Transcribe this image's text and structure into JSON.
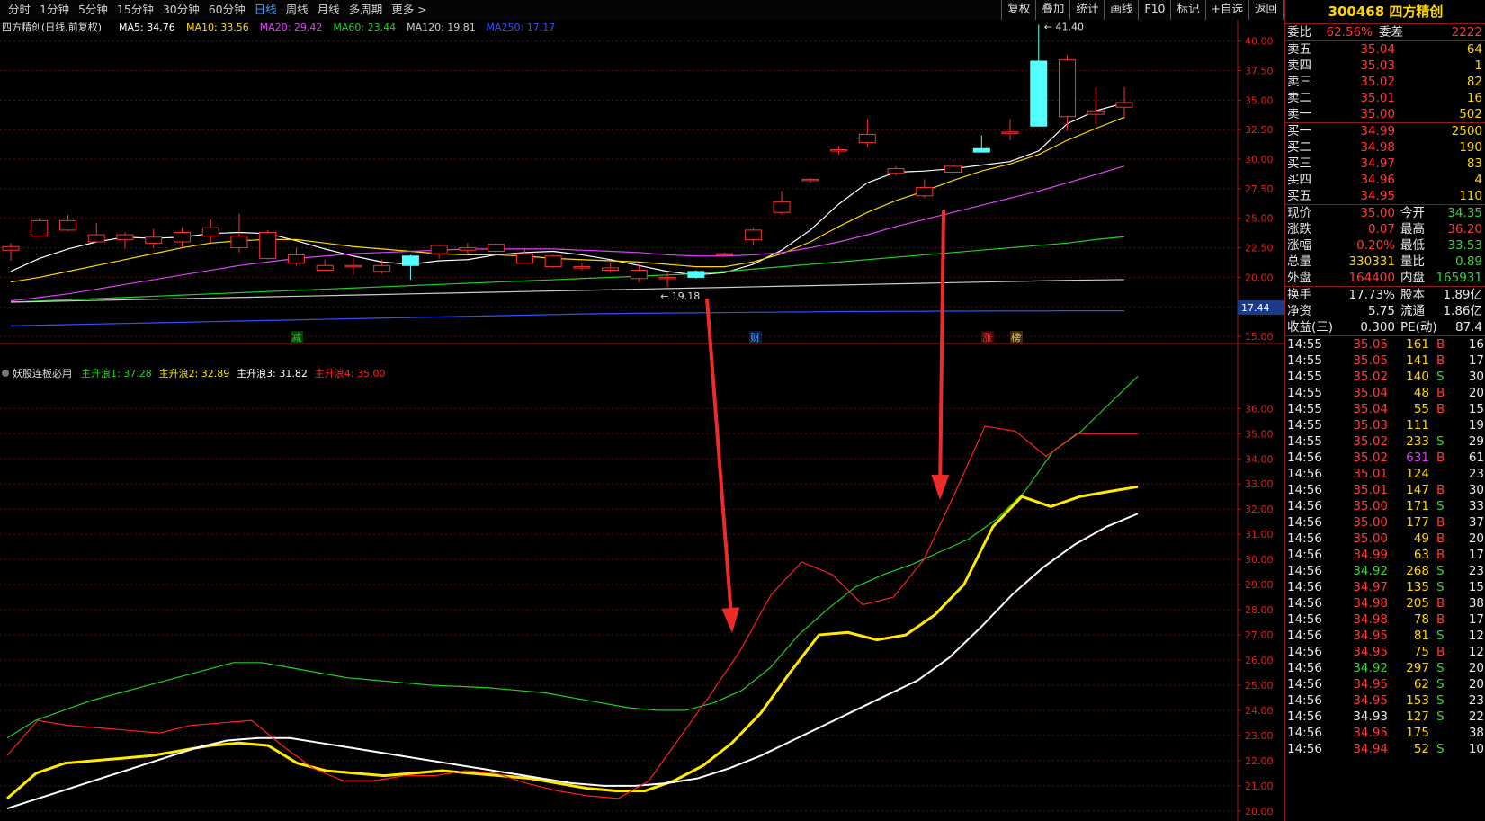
{
  "toolbar": {
    "periods": [
      "分时",
      "1分钟",
      "5分钟",
      "15分钟",
      "30分钟",
      "60分钟",
      "日线",
      "周线",
      "月线",
      "多周期",
      "更多"
    ],
    "active_period": "日线",
    "tools": [
      "复权",
      "叠加",
      "统计",
      "画线",
      "F10",
      "标记",
      "+自选",
      "返回"
    ]
  },
  "main_chart": {
    "title": "四方精创(日线,前复权)",
    "ma": [
      {
        "label": "MA5: 34.76",
        "color": "#ffffff"
      },
      {
        "label": "MA10: 33.56",
        "color": "#ffd700"
      },
      {
        "label": "MA20: 29.42",
        "color": "#e040fb"
      },
      {
        "label": "MA60: 23.44",
        "color": "#20d020"
      },
      {
        "label": "MA120: 19.81",
        "color": "#cccccc"
      },
      {
        "label": "MA250: 17.17",
        "color": "#3050ff"
      }
    ],
    "y_ticks": [
      "40.00",
      "37.50",
      "35.00",
      "32.50",
      "30.00",
      "27.50",
      "25.00",
      "22.50",
      "20.00",
      "17.50",
      "15.00"
    ],
    "price_flag": "17.44",
    "high_note": "41.40",
    "low_note": "19.18",
    "markers": [
      "减",
      "财",
      "涨",
      "榜"
    ]
  },
  "indicator": {
    "name": "妖股连板必用",
    "lines": [
      {
        "label": "主升浪1: 37.28",
        "color": "#20d020"
      },
      {
        "label": "主升浪2: 32.89",
        "color": "#ffea00"
      },
      {
        "label": "主升浪3: 31.82",
        "color": "#ffffff"
      },
      {
        "label": "主升浪4: 35.00",
        "color": "#ff2020"
      }
    ],
    "y_ticks": [
      "36.00",
      "35.00",
      "34.00",
      "33.00",
      "32.00",
      "31.00",
      "30.00",
      "29.00",
      "28.00",
      "27.00",
      "26.00",
      "25.00",
      "24.00",
      "23.00",
      "22.00",
      "21.00",
      "20.00"
    ]
  },
  "chart_data": {
    "type": "line",
    "title": "四方精创(日线,前复权)",
    "x": [
      "1",
      "2",
      "3",
      "4",
      "5",
      "6",
      "7",
      "8",
      "9",
      "10",
      "11",
      "12",
      "13",
      "14",
      "15",
      "16",
      "17",
      "18",
      "19",
      "20",
      "21",
      "22",
      "23",
      "24",
      "25",
      "26",
      "27",
      "28",
      "29",
      "30",
      "31",
      "32",
      "33",
      "34",
      "35",
      "36",
      "37",
      "38",
      "39"
    ],
    "ylim": [
      15,
      41.4
    ],
    "candles": {
      "open": [
        22.3,
        23.5,
        24.0,
        23.0,
        23.2,
        22.9,
        23.0,
        23.5,
        22.5,
        21.6,
        21.2,
        20.6,
        20.9,
        20.5,
        21.8,
        22.0,
        22.3,
        22.2,
        21.2,
        20.9,
        20.8,
        20.6,
        19.9,
        20.0,
        20.5,
        22.0,
        23.2,
        25.5,
        28.2,
        30.8,
        31.4,
        28.8,
        26.9,
        28.9,
        30.9,
        32.3,
        38.3,
        33.6,
        33.8,
        34.4
      ],
      "close": [
        22.6,
        24.8,
        24.8,
        23.6,
        23.6,
        23.4,
        23.8,
        24.2,
        23.5,
        23.8,
        21.9,
        21.0,
        21.0,
        21.0,
        21.0,
        22.7,
        22.5,
        22.8,
        22.0,
        21.8,
        20.9,
        20.8,
        20.6,
        20.0,
        20.0,
        22.0,
        24.0,
        26.4,
        28.3,
        30.8,
        32.1,
        29.2,
        27.6,
        29.4,
        30.6,
        32.3,
        32.8,
        38.4,
        34.1,
        34.8
      ],
      "high": [
        22.9,
        25.0,
        25.3,
        24.6,
        23.8,
        24.1,
        24.2,
        24.9,
        25.4,
        24.0,
        22.5,
        21.5,
        21.6,
        21.5,
        21.9,
        22.8,
        22.9,
        22.9,
        22.5,
        21.9,
        21.2,
        21.2,
        21.1,
        20.4,
        20.6,
        22.1,
        24.2,
        27.3,
        28.4,
        31.1,
        33.4,
        29.4,
        28.3,
        30.0,
        32.0,
        33.4,
        41.4,
        38.8,
        36.1,
        36.1
      ],
      "low": [
        21.4,
        23.5,
        23.9,
        22.9,
        22.4,
        22.5,
        22.5,
        22.9,
        22.1,
        21.5,
        21.0,
        20.6,
        20.2,
        20.3,
        19.8,
        21.6,
        21.9,
        22.1,
        21.2,
        20.8,
        20.6,
        20.4,
        19.6,
        19.2,
        19.9,
        21.9,
        22.8,
        25.3,
        28.0,
        30.4,
        31.0,
        28.6,
        26.7,
        28.6,
        30.6,
        31.6,
        32.8,
        32.4,
        33.0,
        33.4
      ]
    },
    "series": [
      {
        "name": "MA5",
        "values": [
          20.5,
          21.6,
          22.4,
          23.0,
          23.4,
          23.3,
          23.4,
          23.7,
          23.8,
          23.7,
          23.1,
          22.4,
          21.8,
          21.3,
          21.1,
          21.4,
          21.5,
          21.9,
          22.1,
          22.2,
          21.9,
          21.5,
          21.0,
          20.5,
          20.2,
          20.4,
          21.1,
          22.3,
          24.0,
          26.2,
          28.0,
          28.9,
          29.0,
          29.2,
          29.5,
          29.8,
          30.7,
          33.0,
          34.1,
          34.76
        ]
      },
      {
        "name": "MA10",
        "values": [
          19.6,
          20.0,
          20.5,
          21.0,
          21.5,
          22.0,
          22.5,
          22.9,
          23.1,
          23.2,
          23.2,
          22.9,
          22.6,
          22.4,
          22.2,
          22.0,
          21.9,
          21.9,
          21.8,
          21.6,
          21.5,
          21.4,
          21.3,
          21.1,
          20.9,
          20.9,
          21.3,
          22.0,
          23.0,
          24.3,
          25.5,
          26.5,
          27.3,
          28.2,
          29.0,
          29.6,
          30.4,
          31.6,
          32.6,
          33.56
        ]
      },
      {
        "name": "MA20",
        "values": [
          18.0,
          18.3,
          18.6,
          19.0,
          19.4,
          19.8,
          20.2,
          20.6,
          21.0,
          21.3,
          21.6,
          21.8,
          22.0,
          22.1,
          22.2,
          22.3,
          22.4,
          22.4,
          22.4,
          22.4,
          22.3,
          22.2,
          22.1,
          21.9,
          21.8,
          21.8,
          21.9,
          22.1,
          22.5,
          23.0,
          23.6,
          24.3,
          24.9,
          25.5,
          26.1,
          26.7,
          27.3,
          28.0,
          28.7,
          29.42
        ]
      },
      {
        "name": "MA60",
        "values": [
          17.9,
          18.0,
          18.1,
          18.2,
          18.3,
          18.4,
          18.5,
          18.6,
          18.7,
          18.8,
          18.9,
          19.0,
          19.1,
          19.2,
          19.3,
          19.4,
          19.5,
          19.6,
          19.7,
          19.8,
          19.9,
          20.0,
          20.1,
          20.2,
          20.3,
          20.5,
          20.7,
          20.9,
          21.1,
          21.3,
          21.5,
          21.7,
          21.9,
          22.1,
          22.3,
          22.5,
          22.7,
          22.9,
          23.2,
          23.44
        ]
      },
      {
        "name": "MA120",
        "values": [
          17.9,
          17.95,
          18.0,
          18.05,
          18.1,
          18.15,
          18.2,
          18.25,
          18.3,
          18.35,
          18.4,
          18.45,
          18.5,
          18.55,
          18.6,
          18.65,
          18.7,
          18.75,
          18.8,
          18.85,
          18.9,
          18.95,
          19.0,
          19.05,
          19.1,
          19.15,
          19.2,
          19.25,
          19.3,
          19.35,
          19.4,
          19.45,
          19.5,
          19.55,
          19.6,
          19.65,
          19.7,
          19.75,
          19.78,
          19.81
        ]
      },
      {
        "name": "MA250",
        "values": [
          15.9,
          15.95,
          16.0,
          16.05,
          16.1,
          16.15,
          16.2,
          16.25,
          16.3,
          16.35,
          16.4,
          16.45,
          16.5,
          16.55,
          16.6,
          16.65,
          16.7,
          16.75,
          16.8,
          16.85,
          16.9,
          16.93,
          16.96,
          16.98,
          17.0,
          17.02,
          17.04,
          17.06,
          17.08,
          17.1,
          17.11,
          17.12,
          17.13,
          17.14,
          17.15,
          17.16,
          17.16,
          17.17,
          17.17,
          17.17
        ]
      },
      {
        "name": "主升浪1",
        "values": [
          22.9,
          23.6,
          24.0,
          24.4,
          24.7,
          25.0,
          25.3,
          25.6,
          25.9,
          25.9,
          25.7,
          25.5,
          25.3,
          25.2,
          25.1,
          25.0,
          24.95,
          24.9,
          24.8,
          24.7,
          24.5,
          24.3,
          24.1,
          24.0,
          24.0,
          24.3,
          24.8,
          25.7,
          27.0,
          28.0,
          28.9,
          29.4,
          29.8,
          30.3,
          30.8,
          31.6,
          32.7,
          34.3,
          35.1,
          36.2,
          37.28
        ]
      },
      {
        "name": "主升浪2",
        "values": [
          20.5,
          21.5,
          21.9,
          22.0,
          22.1,
          22.2,
          22.4,
          22.6,
          22.7,
          22.6,
          21.9,
          21.6,
          21.5,
          21.4,
          21.5,
          21.6,
          21.5,
          21.4,
          21.3,
          21.1,
          20.9,
          20.8,
          20.8,
          21.2,
          21.8,
          22.7,
          23.9,
          25.5,
          27.0,
          27.1,
          26.8,
          27.0,
          27.8,
          29.0,
          31.3,
          32.5,
          32.1,
          32.5,
          32.7,
          32.89
        ]
      },
      {
        "name": "主升浪3",
        "values": [
          20.1,
          20.5,
          20.9,
          21.3,
          21.7,
          22.1,
          22.5,
          22.8,
          22.9,
          22.9,
          22.7,
          22.5,
          22.3,
          22.1,
          21.9,
          21.7,
          21.5,
          21.3,
          21.1,
          21.0,
          21.0,
          21.1,
          21.3,
          21.7,
          22.2,
          22.8,
          23.4,
          24.0,
          24.6,
          25.2,
          26.1,
          27.3,
          28.6,
          29.7,
          30.6,
          31.3,
          31.82
        ]
      },
      {
        "name": "主升浪4",
        "values": [
          22.2,
          23.6,
          23.4,
          23.3,
          23.2,
          23.1,
          23.4,
          23.5,
          23.6,
          22.6,
          21.7,
          21.2,
          21.2,
          21.4,
          21.4,
          21.6,
          21.5,
          21.1,
          20.8,
          20.6,
          20.5,
          21.2,
          22.9,
          24.6,
          26.4,
          28.6,
          29.9,
          29.4,
          28.2,
          28.5,
          30.0,
          32.6,
          35.3,
          35.1,
          34.1,
          35.0,
          35.0,
          35.0
        ]
      }
    ]
  },
  "quote_panel": {
    "code": "300468",
    "name": "四方精创",
    "wei_bi_label": "委比",
    "wei_bi": "62.56%",
    "wei_cha_label": "委差",
    "wei_cha": "2222",
    "asks": [
      {
        "label": "卖五",
        "price": "35.04",
        "vol": "64"
      },
      {
        "label": "卖四",
        "price": "35.03",
        "vol": "1"
      },
      {
        "label": "卖三",
        "price": "35.02",
        "vol": "82"
      },
      {
        "label": "卖二",
        "price": "35.01",
        "vol": "16"
      },
      {
        "label": "卖一",
        "price": "35.00",
        "vol": "502"
      }
    ],
    "bids": [
      {
        "label": "买一",
        "price": "34.99",
        "vol": "2500"
      },
      {
        "label": "买二",
        "price": "34.98",
        "vol": "190"
      },
      {
        "label": "买三",
        "price": "34.97",
        "vol": "83"
      },
      {
        "label": "买四",
        "price": "34.96",
        "vol": "4"
      },
      {
        "label": "买五",
        "price": "34.95",
        "vol": "110"
      }
    ],
    "stats": [
      {
        "l1": "现价",
        "v1": "35.00",
        "c1": "red",
        "l2": "今开",
        "v2": "34.35",
        "c2": "green"
      },
      {
        "l1": "涨跌",
        "v1": "0.07",
        "c1": "red",
        "l2": "最高",
        "v2": "36.20",
        "c2": "red"
      },
      {
        "l1": "涨幅",
        "v1": "0.20%",
        "c1": "red",
        "l2": "最低",
        "v2": "33.53",
        "c2": "green"
      },
      {
        "l1": "总量",
        "v1": "330331",
        "c1": "yellow",
        "l2": "量比",
        "v2": "0.89",
        "c2": "green"
      },
      {
        "l1": "外盘",
        "v1": "164400",
        "c1": "red",
        "l2": "内盘",
        "v2": "165931",
        "c2": "green"
      }
    ],
    "stats2": [
      {
        "l1": "换手",
        "v1": "17.73%",
        "l2": "股本",
        "v2": "1.89亿"
      },
      {
        "l1": "净资",
        "v1": "5.75",
        "l2": "流通",
        "v2": "1.86亿"
      },
      {
        "l1": "收益(三)",
        "v1": "0.300",
        "l2": "PE(动)",
        "v2": "87.4"
      }
    ],
    "ticks": [
      {
        "t": "14:55",
        "p": "35.05",
        "pc": "red",
        "v": "161",
        "vc": "yellow",
        "d": "B",
        "n": "16"
      },
      {
        "t": "14:55",
        "p": "35.05",
        "pc": "red",
        "v": "141",
        "vc": "yellow",
        "d": "B",
        "n": "17"
      },
      {
        "t": "14:55",
        "p": "35.02",
        "pc": "red",
        "v": "140",
        "vc": "yellow",
        "d": "S",
        "n": "30"
      },
      {
        "t": "14:55",
        "p": "35.04",
        "pc": "red",
        "v": "48",
        "vc": "yellow",
        "d": "B",
        "n": "20"
      },
      {
        "t": "14:55",
        "p": "35.04",
        "pc": "red",
        "v": "55",
        "vc": "yellow",
        "d": "B",
        "n": "15"
      },
      {
        "t": "14:55",
        "p": "35.03",
        "pc": "red",
        "v": "111",
        "vc": "yellow",
        "d": "",
        "n": "19"
      },
      {
        "t": "14:55",
        "p": "35.02",
        "pc": "red",
        "v": "233",
        "vc": "yellow",
        "d": "S",
        "n": "29"
      },
      {
        "t": "14:56",
        "p": "35.02",
        "pc": "red",
        "v": "631",
        "vc": "mag",
        "d": "B",
        "n": "61"
      },
      {
        "t": "14:56",
        "p": "35.01",
        "pc": "red",
        "v": "124",
        "vc": "yellow",
        "d": "",
        "n": "23"
      },
      {
        "t": "14:56",
        "p": "35.01",
        "pc": "red",
        "v": "147",
        "vc": "yellow",
        "d": "B",
        "n": "30"
      },
      {
        "t": "14:56",
        "p": "35.00",
        "pc": "red",
        "v": "171",
        "vc": "yellow",
        "d": "S",
        "n": "33"
      },
      {
        "t": "14:56",
        "p": "35.00",
        "pc": "red",
        "v": "177",
        "vc": "yellow",
        "d": "B",
        "n": "37"
      },
      {
        "t": "14:56",
        "p": "35.00",
        "pc": "red",
        "v": "49",
        "vc": "yellow",
        "d": "B",
        "n": "20"
      },
      {
        "t": "14:56",
        "p": "34.99",
        "pc": "red",
        "v": "63",
        "vc": "yellow",
        "d": "B",
        "n": "17"
      },
      {
        "t": "14:56",
        "p": "34.92",
        "pc": "green",
        "v": "268",
        "vc": "yellow",
        "d": "S",
        "n": "23"
      },
      {
        "t": "14:56",
        "p": "34.97",
        "pc": "red",
        "v": "135",
        "vc": "yellow",
        "d": "S",
        "n": "15"
      },
      {
        "t": "14:56",
        "p": "34.98",
        "pc": "red",
        "v": "205",
        "vc": "yellow",
        "d": "B",
        "n": "38"
      },
      {
        "t": "14:56",
        "p": "34.98",
        "pc": "red",
        "v": "78",
        "vc": "yellow",
        "d": "B",
        "n": "17"
      },
      {
        "t": "14:56",
        "p": "34.95",
        "pc": "red",
        "v": "81",
        "vc": "yellow",
        "d": "S",
        "n": "12"
      },
      {
        "t": "14:56",
        "p": "34.95",
        "pc": "red",
        "v": "75",
        "vc": "yellow",
        "d": "B",
        "n": "12"
      },
      {
        "t": "14:56",
        "p": "34.92",
        "pc": "green",
        "v": "297",
        "vc": "yellow",
        "d": "S",
        "n": "20"
      },
      {
        "t": "14:56",
        "p": "34.95",
        "pc": "red",
        "v": "62",
        "vc": "yellow",
        "d": "S",
        "n": "20"
      },
      {
        "t": "14:56",
        "p": "34.95",
        "pc": "red",
        "v": "153",
        "vc": "yellow",
        "d": "S",
        "n": "23"
      },
      {
        "t": "14:56",
        "p": "34.93",
        "pc": "white",
        "v": "127",
        "vc": "yellow",
        "d": "S",
        "n": "22"
      },
      {
        "t": "14:56",
        "p": "34.95",
        "pc": "red",
        "v": "175",
        "vc": "yellow",
        "d": "",
        "n": "38"
      },
      {
        "t": "14:56",
        "p": "34.94",
        "pc": "red",
        "v": "52",
        "vc": "yellow",
        "d": "S",
        "n": "10"
      }
    ]
  }
}
